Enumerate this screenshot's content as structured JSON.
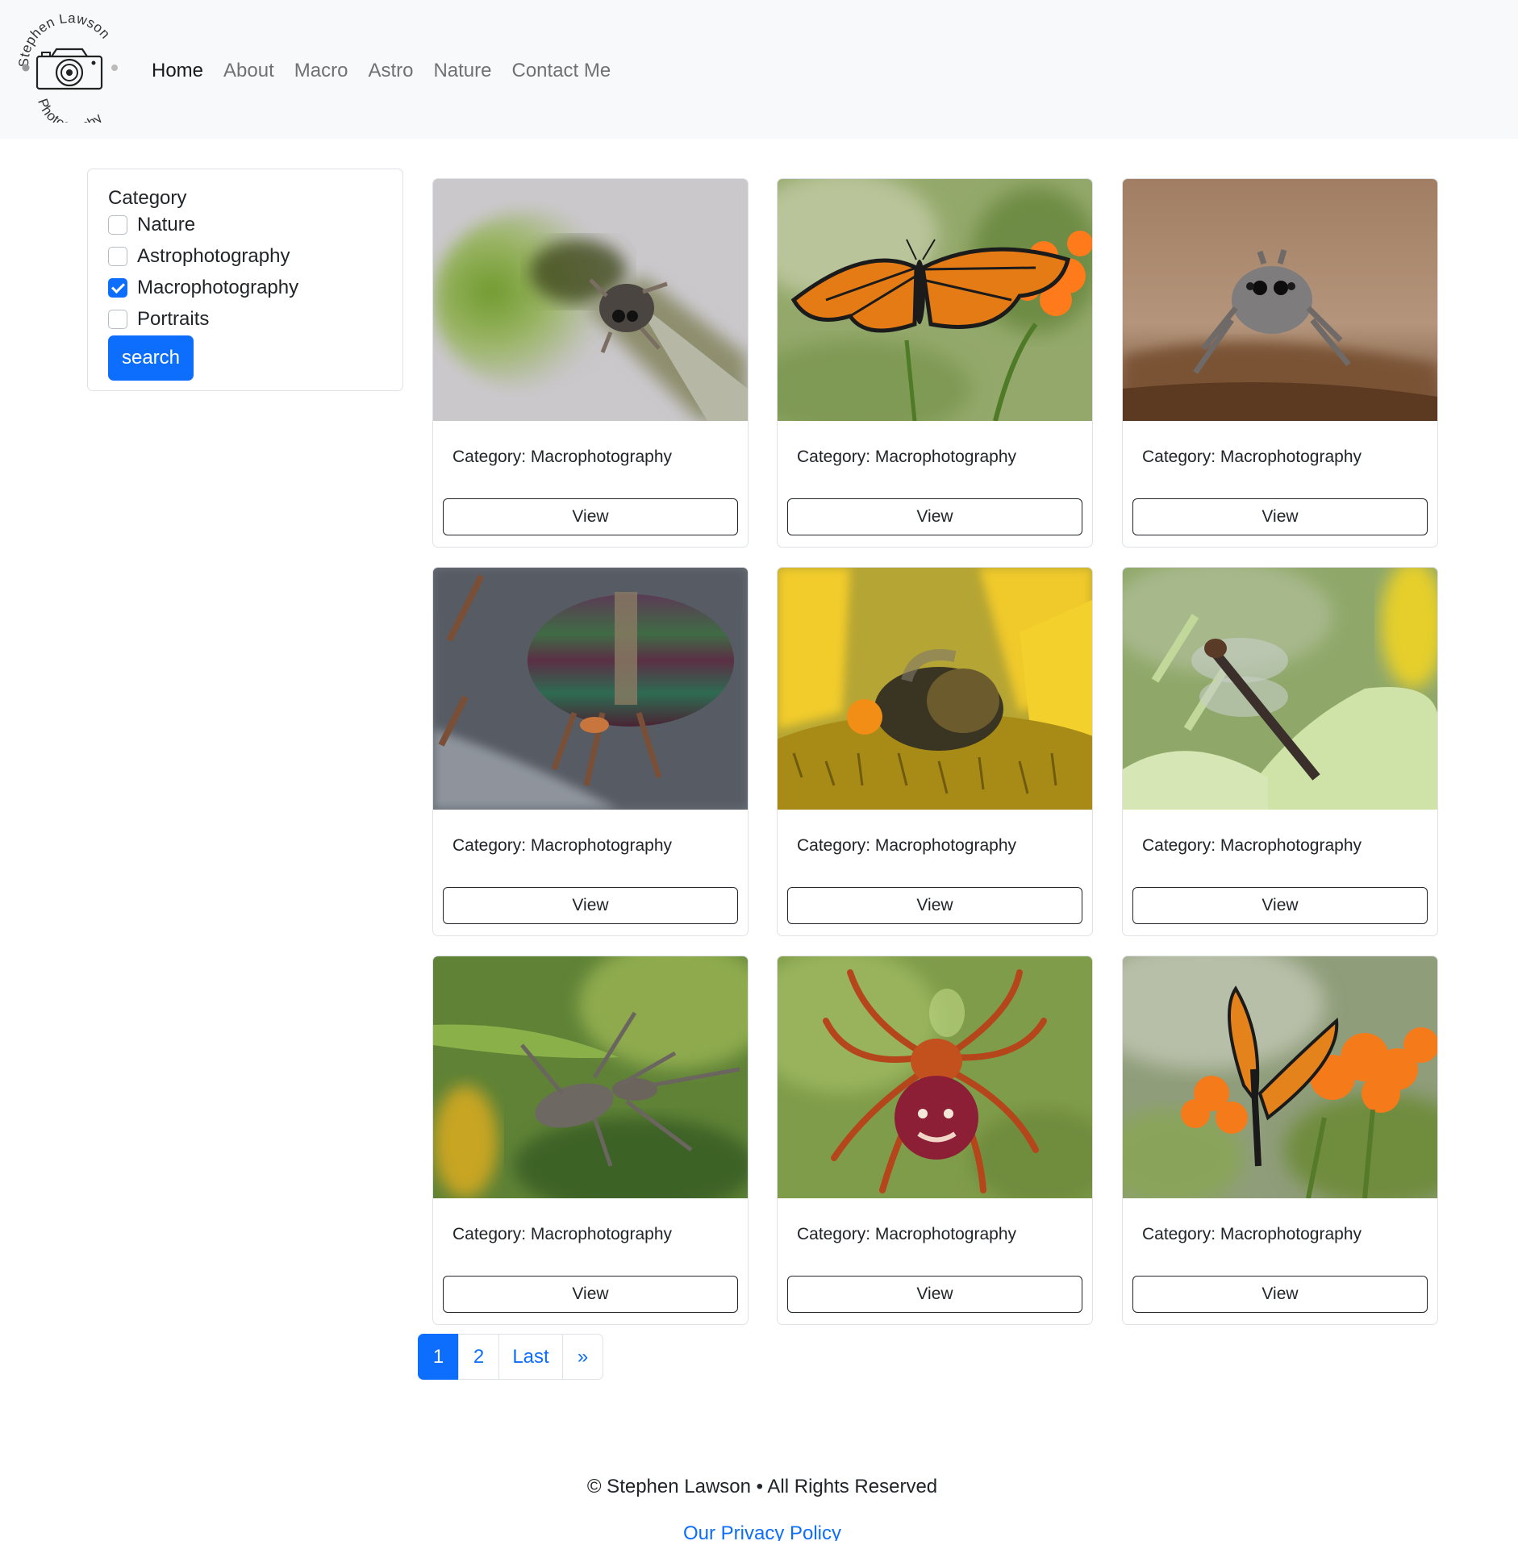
{
  "brand": {
    "logo_text_top": "Stephen Lawson",
    "logo_text_bottom": "Photography",
    "logo_icon": "camera-icon"
  },
  "nav": {
    "items": [
      {
        "label": "Home",
        "active": true
      },
      {
        "label": "About",
        "active": false
      },
      {
        "label": "Macro",
        "active": false
      },
      {
        "label": "Astro",
        "active": false
      },
      {
        "label": "Nature",
        "active": false
      },
      {
        "label": "Contact Me",
        "active": false
      }
    ]
  },
  "filter": {
    "title": "Category",
    "options": [
      {
        "label": "Nature",
        "checked": false
      },
      {
        "label": "Astrophotography",
        "checked": false
      },
      {
        "label": "Macrophotography",
        "checked": true
      },
      {
        "label": "Portraits",
        "checked": false
      }
    ],
    "search_label": "search"
  },
  "cards": [
    {
      "image": "jumping-spider-on-stem-photo",
      "category_prefix": "Category:",
      "category": "Macrophotography",
      "button": "View"
    },
    {
      "image": "monarch-butterfly-photo",
      "category_prefix": "Category:",
      "category": "Macrophotography",
      "button": "View"
    },
    {
      "image": "jumping-spider-on-wood-photo",
      "category_prefix": "Category:",
      "category": "Macrophotography",
      "button": "View"
    },
    {
      "image": "horsefly-eyes-photo",
      "category_prefix": "Category:",
      "category": "Macrophotography",
      "button": "View"
    },
    {
      "image": "bumblebee-on-sunflower-photo",
      "category_prefix": "Category:",
      "category": "Macrophotography",
      "button": "View"
    },
    {
      "image": "dragonfly-on-plant-photo",
      "category_prefix": "Category:",
      "category": "Macrophotography",
      "button": "View"
    },
    {
      "image": "assassin-bug-photo",
      "category_prefix": "Category:",
      "category": "Macrophotography",
      "button": "View"
    },
    {
      "image": "orb-weaver-spider-photo",
      "category_prefix": "Category:",
      "category": "Macrophotography",
      "button": "View"
    },
    {
      "image": "monarch-on-milkweed-photo",
      "category_prefix": "Category:",
      "category": "Macrophotography",
      "button": "View"
    }
  ],
  "pagination": {
    "items": [
      {
        "label": "1",
        "active": true
      },
      {
        "label": "2",
        "active": false
      },
      {
        "label": "Last",
        "active": false
      },
      {
        "label": "»",
        "active": false
      }
    ]
  },
  "footer": {
    "copyright": "© Stephen Lawson • All Rights Reserved",
    "privacy_link": "Our Privacy Policy"
  },
  "colors": {
    "primary": "#0d6efd",
    "navbar_bg": "#f8f9fa",
    "border": "#dee2e6",
    "text": "#212529"
  }
}
